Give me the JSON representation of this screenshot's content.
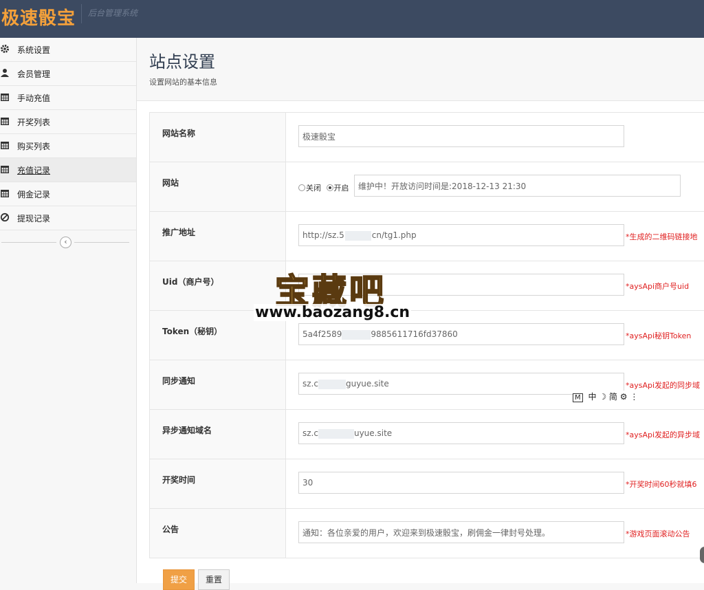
{
  "header": {
    "brand": "极速骰宝",
    "subtitle": "后台管理系统"
  },
  "sidebar": {
    "items": [
      {
        "label": "系统设置",
        "icon": "gear-icon"
      },
      {
        "label": "会员管理",
        "icon": "user-icon"
      },
      {
        "label": "手动充值",
        "icon": "calendar-icon"
      },
      {
        "label": "开奖列表",
        "icon": "calendar-icon"
      },
      {
        "label": "购买列表",
        "icon": "calendar-icon"
      },
      {
        "label": "充值记录",
        "icon": "calendar-icon"
      },
      {
        "label": "佣金记录",
        "icon": "calendar-icon"
      },
      {
        "label": "提现记录",
        "icon": "ban-icon"
      }
    ],
    "collapse_icon": "‹"
  },
  "page": {
    "title": "站点设置",
    "subtitle": "设置网站的基本信息"
  },
  "form": {
    "site_name": {
      "label": "网站名称",
      "value": "极速骰宝"
    },
    "site_status": {
      "label": "网站",
      "option_off": "关闭",
      "option_on": "开启",
      "selected": "开启",
      "maintenance_text": "维护中！开放访问时间是:2018-12-13 21:30"
    },
    "promo_url": {
      "label": "推广地址",
      "value": "http://sz.5",
      "value_tail": "cn/tg1.php",
      "hint": "*生成的二维码链接地"
    },
    "uid": {
      "label": "Uid（商户号）",
      "value": "",
      "hint": "*aysApi商户号uid"
    },
    "token": {
      "label": "Token（秘钥）",
      "value": "5a4f2589",
      "value_tail": "9885611716fd37860",
      "hint": "*aysApi秘钥Token"
    },
    "sync_notify": {
      "label": "同步通知",
      "value": "sz.c",
      "value_tail": "guyue.site",
      "hint": "*aysApi发起的同步域"
    },
    "async_notify": {
      "label": "异步通知域名",
      "value": "sz.c",
      "value_tail": "uyue.site",
      "hint": "*aysApi发起的异步域"
    },
    "draw_time": {
      "label": "开奖时间",
      "value": "30",
      "hint": "*开奖时间60秒就填6"
    },
    "notice": {
      "label": "公告",
      "value": "通知：各位亲爱的用户，欢迎来到极速骰宝，刷佣金一律封号处理。",
      "hint": "*游戏页面滚动公告"
    }
  },
  "buttons": {
    "submit": "提交",
    "reset": "重置"
  },
  "ime_toolbar": {
    "mode": "M",
    "lang": "中",
    "moon": "☽",
    "simplified": "简",
    "gear": "⚙",
    "more": "⋮"
  },
  "watermark": {
    "logo": "宝藏吧",
    "url": "www.baozang8.cn"
  },
  "colors": {
    "topbar": "#3c4a61",
    "brand": "#f5a13a",
    "hint": "#e02020",
    "submit": "#f0a045"
  }
}
